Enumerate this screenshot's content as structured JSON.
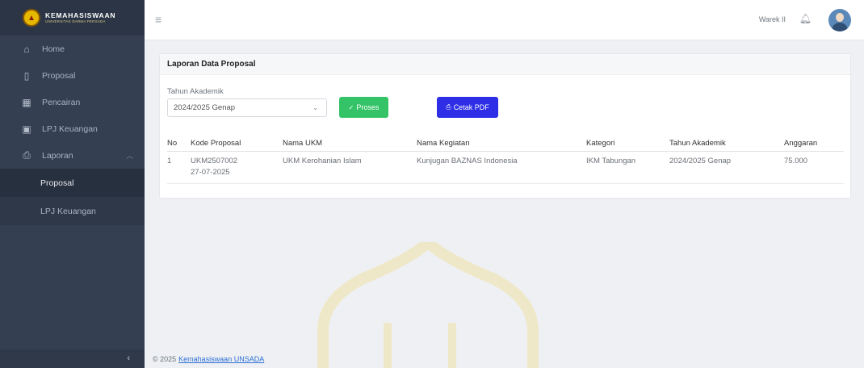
{
  "brand": {
    "title": "KEMAHASISWAAN",
    "subtitle": "UNIVERSITAS DARMA PERSADA"
  },
  "sidebar": {
    "items": [
      {
        "label": "Home",
        "icon": "home-icon"
      },
      {
        "label": "Proposal",
        "icon": "file-icon"
      },
      {
        "label": "Pencairan",
        "icon": "bank-icon"
      },
      {
        "label": "LPJ Keuangan",
        "icon": "report-icon"
      },
      {
        "label": "Laporan",
        "icon": "printer-icon"
      }
    ],
    "laporan_sub": [
      {
        "label": "Proposal",
        "active": true
      },
      {
        "label": "LPJ Keuangan",
        "active": false
      }
    ]
  },
  "topbar": {
    "user_name": "Warek II"
  },
  "card": {
    "title": "Laporan Data Proposal",
    "filter_label": "Tahun Akademik",
    "filter_value": "2024/2025 Genap",
    "proses_label": "Proses",
    "pdf_label": "Cetak PDF"
  },
  "table": {
    "headers": [
      "No",
      "Kode Proposal",
      "Nama UKM",
      "Nama Kegiatan",
      "Kategori",
      "Tahun Akademik",
      "Anggaran"
    ],
    "rows": [
      {
        "no": "1",
        "kode": "UKM2507002",
        "tanggal": "27-07-2025",
        "nama_ukm": "UKM Kerohanian Islam",
        "kegiatan": "Kunjugan BAZNAS Indonesia",
        "kategori": "IKM Tabungan",
        "tahun": "2024/2025 Genap",
        "anggaran": "75.000"
      }
    ]
  },
  "footer": {
    "copyright": "© 2025",
    "link_text": "Kemahasiswaan UNSADA"
  },
  "colors": {
    "sidebar_bg": "#343f52",
    "proses_button": "#34c467",
    "pdf_button": "#2d2ee6",
    "link": "#2d6fd6"
  }
}
